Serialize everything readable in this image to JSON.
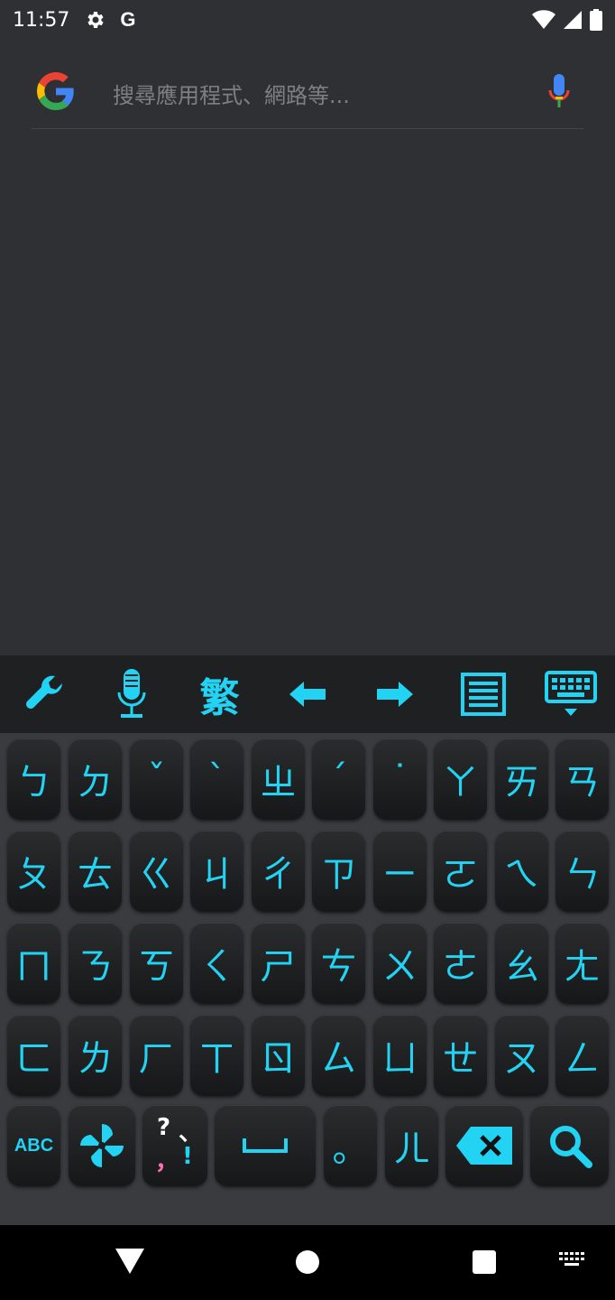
{
  "status": {
    "time": "11:57",
    "g_label": "G"
  },
  "search": {
    "placeholder": "搜尋應用程式、網路等..."
  },
  "toolbar": {
    "trad_label": "繁"
  },
  "keyboard": {
    "rows": [
      [
        "ㄅ",
        "ㄉ",
        "ˇ",
        "ˋ",
        "ㄓ",
        "ˊ",
        "˙",
        "ㄚ",
        "ㄞ",
        "ㄢ"
      ],
      [
        "ㄆ",
        "ㄊ",
        "ㄍ",
        "ㄐ",
        "ㄔ",
        "ㄗ",
        "ㄧ",
        "ㄛ",
        "ㄟ",
        "ㄣ"
      ],
      [
        "ㄇ",
        "ㄋ",
        "ㄎ",
        "ㄑ",
        "ㄕ",
        "ㄘ",
        "ㄨ",
        "ㄜ",
        "ㄠ",
        "ㄤ"
      ],
      [
        "ㄈ",
        "ㄌ",
        "ㄏ",
        "ㄒ",
        "ㄖ",
        "ㄙ",
        "ㄩ",
        "ㄝ",
        "ㄡ",
        "ㄥ"
      ]
    ],
    "abc_label": "ABC",
    "punct": {
      "q": "?",
      "dun": "、",
      "comma": "，",
      "excl": "!"
    },
    "period": "。",
    "er": "ㄦ"
  },
  "colors": {
    "accent": "#22d3f4",
    "keyboard_bg": "#3a3b3f",
    "toolbar_bg": "#1f2022",
    "screen_bg": "#2f3034"
  }
}
